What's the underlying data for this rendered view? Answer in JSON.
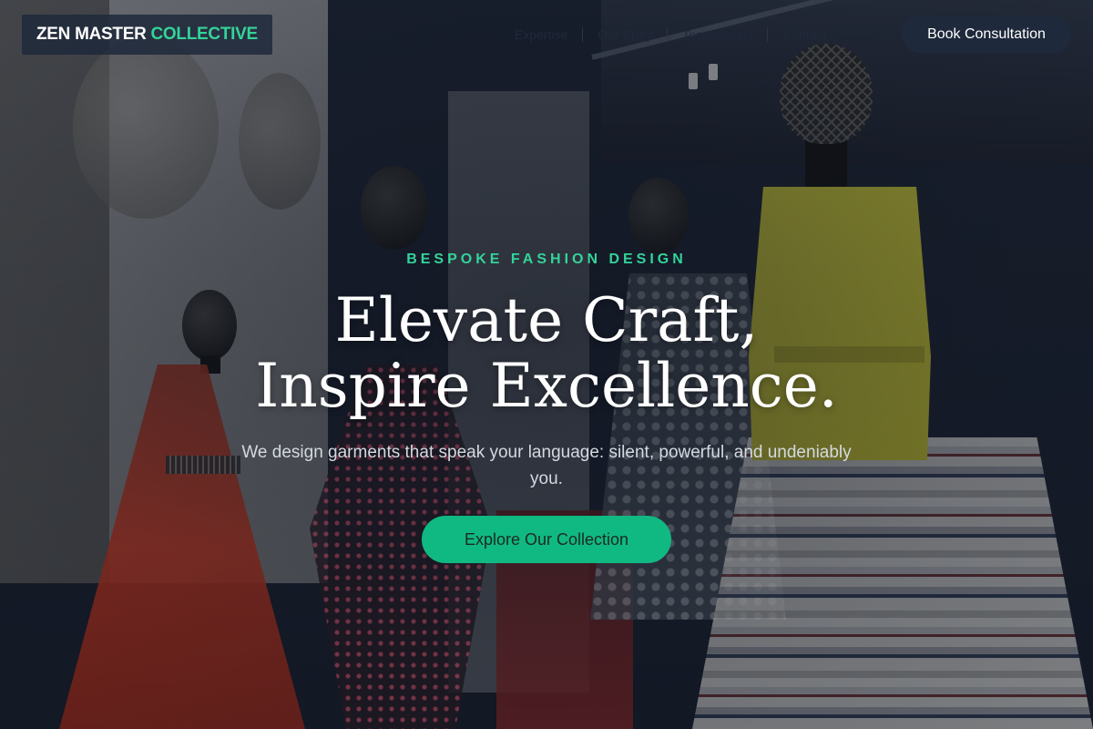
{
  "header": {
    "logo_primary": "ZEN MASTER",
    "logo_accent": "COLLECTIVE",
    "nav": [
      {
        "label": "Expertise"
      },
      {
        "label": "Our Story"
      },
      {
        "label": "Testimonials"
      },
      {
        "label": "Contact"
      }
    ],
    "book_label": "Book Consultation"
  },
  "hero": {
    "eyebrow": "BESPOKE FASHION DESIGN",
    "headline_line1": "Elevate Craft,",
    "headline_line2": "Inspire Excellence.",
    "subtitle": "We design garments that speak your language: silent, powerful, and undeniably you.",
    "cta_label": "Explore Our Collection"
  },
  "colors": {
    "accent": "#34d399",
    "cta": "#10b981",
    "navy": "#1e293b"
  }
}
